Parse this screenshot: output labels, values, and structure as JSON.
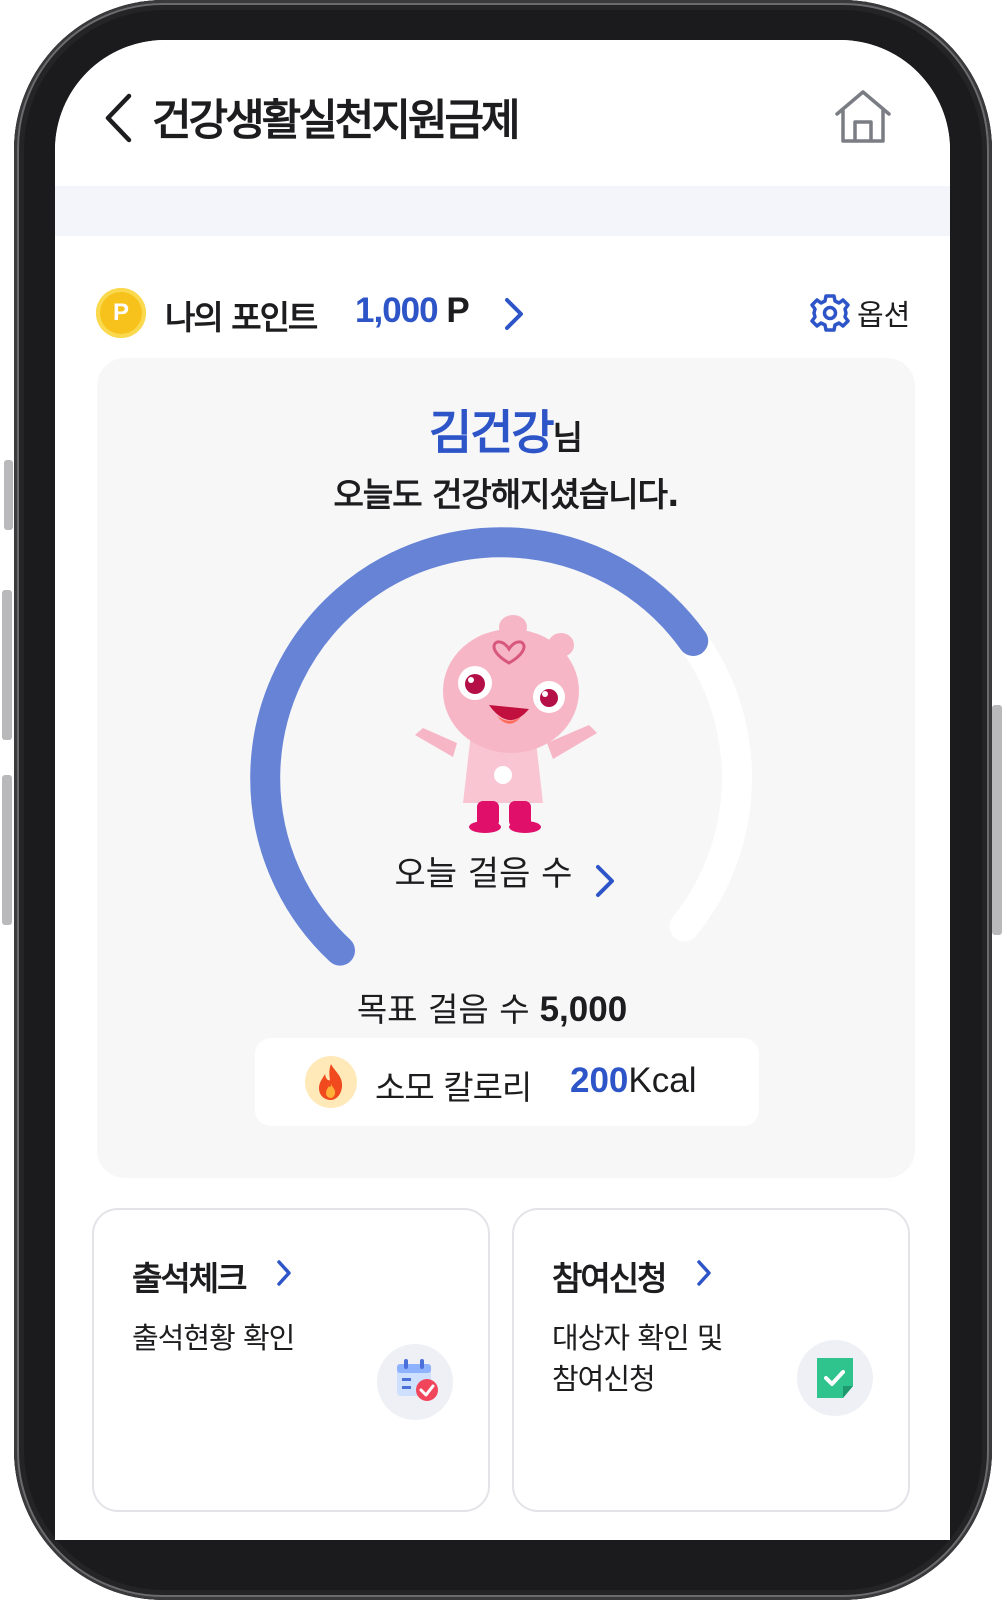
{
  "header": {
    "title": "건강생활실천지원금제"
  },
  "points": {
    "coin_label": "P",
    "label": "나의 포인트",
    "value": "1,000",
    "unit": "P",
    "option_label": "옵션"
  },
  "summary": {
    "user_name": "김건강",
    "name_suffix": "님",
    "message": "오늘도 건강해지셨습니다.",
    "today_steps_label": "오늘 걸음 수",
    "steps_progress": 0.72,
    "goal_label": "목표 걸음 수",
    "goal_value": "5,000",
    "calorie_label": "소모 칼로리",
    "calorie_value": "200",
    "calorie_unit": "Kcal"
  },
  "tiles": [
    {
      "title": "출석체크",
      "desc_line1": "출석현황 확인",
      "desc_line2": ""
    },
    {
      "title": "참여신청",
      "desc_line1": "대상자 확인 및",
      "desc_line2": "참여신청"
    }
  ],
  "colors": {
    "accent": "#2d55c8",
    "gauge": "#6683d6",
    "card_bg": "#f7f7f8",
    "coin": "#f7c21b"
  },
  "icons": [
    "back-icon",
    "home-icon",
    "point-coin-icon",
    "chevron-right-icon",
    "gear-icon",
    "mascot-illustration",
    "fire-icon",
    "calendar-check-icon",
    "document-check-icon"
  ]
}
